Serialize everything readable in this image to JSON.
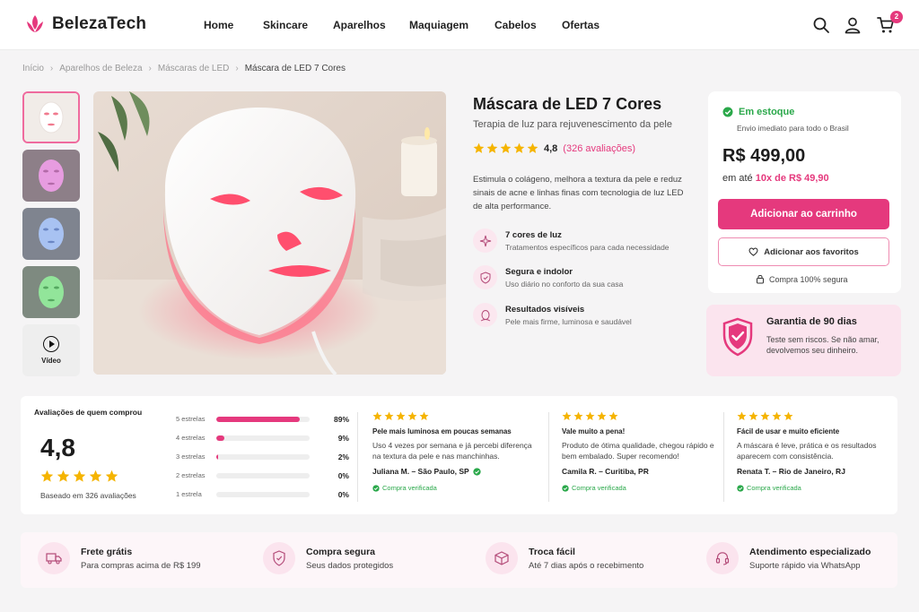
{
  "brand": {
    "name": "BelezaTech",
    "accent": "#e5397d"
  },
  "nav": [
    "Home",
    "Skincare",
    "Aparelhos",
    "Maquiagem",
    "Cabelos",
    "Ofertas"
  ],
  "header_icons": [
    "search-icon",
    "user-icon",
    "cart-icon"
  ],
  "cart_count": "2",
  "breadcrumb": [
    "Início",
    "Aparelhos de Beleza",
    "Máscaras de LED",
    "Máscara de LED 7 Cores"
  ],
  "gallery": {
    "thumbnails": [
      "white-mask",
      "pink-mask",
      "blue-mask",
      "green-mask"
    ],
    "video_label": "Vídeo"
  },
  "product": {
    "title": "Máscara de LED 7 Cores",
    "subtitle": "Terapia de luz para rejuvenescimento da pele",
    "rating": "4,8",
    "rating_count": "(326 avaliações)",
    "description": "Estimula o colágeno, melhora a textura da pele e reduz sinais de acne e linhas finas com tecnologia de luz LED de alta performance.",
    "features": [
      {
        "icon": "sparkle-icon",
        "title": "7 cores de luz",
        "subtitle": "Tratamentos específicos para cada necessidade"
      },
      {
        "icon": "shield-icon",
        "title": "Segura e indolor",
        "subtitle": "Uso diário no conforto da sua casa"
      },
      {
        "icon": "face-icon",
        "title": "Resultados visíveis",
        "subtitle": "Pele mais firme, luminosa e saudável"
      }
    ]
  },
  "buybox": {
    "stock": "Em estoque",
    "shipping": "Envio imediato para todo o Brasil",
    "price": "R$ 499,00",
    "installment_prefix": "em até",
    "installment": "10x de R$ 49,90",
    "add_to_cart": "Adicionar ao carrinho",
    "add_to_favorites": "Adicionar aos favoritos",
    "secure": "Compra 100% segura"
  },
  "guarantee": {
    "title": "Garantia de 90 dias",
    "text": "Teste sem riscos. Se não amar, devolvemos seu dinheiro."
  },
  "reviews": {
    "heading": "Avaliações de quem comprou",
    "average": "4,8",
    "based_on": "Baseado em 326 avaliações",
    "distribution": [
      {
        "label": "5 estrelas",
        "pct": "89%",
        "value": 89
      },
      {
        "label": "4 estrelas",
        "pct": "9%",
        "value": 9
      },
      {
        "label": "3 estrelas",
        "pct": "2%",
        "value": 2
      },
      {
        "label": "2 estrelas",
        "pct": "0%",
        "value": 0
      },
      {
        "label": "1 estrela",
        "pct": "0%",
        "value": 0
      }
    ],
    "items": [
      {
        "title": "Pele mais luminosa em poucas semanas",
        "text": "Uso 4 vezes por semana e já percebi diferença na textura da pele e nas manchinhas.",
        "author": "Juliana M. – São Paulo, SP",
        "verified": "Compra verificada"
      },
      {
        "title": "Vale muito a pena!",
        "text": "Produto de ótima qualidade, chegou rápido e bem embalado. Super recomendo!",
        "author": "Camila R. – Curitiba, PR",
        "verified": "Compra verificada"
      },
      {
        "title": "Fácil de usar e muito eficiente",
        "text": "A máscara é leve, prática e os resultados aparecem com consistência.",
        "author": "Renata T. – Rio de Janeiro, RJ",
        "verified": "Compra verificada"
      }
    ]
  },
  "benefits": [
    {
      "icon": "truck-icon",
      "title": "Frete grátis",
      "subtitle": "Para compras acima de R$ 199"
    },
    {
      "icon": "shield-icon",
      "title": "Compra segura",
      "subtitle": "Seus dados protegidos"
    },
    {
      "icon": "box-icon",
      "title": "Troca fácil",
      "subtitle": "Até 7 dias após o recebimento"
    },
    {
      "icon": "headset-icon",
      "title": "Atendimento especializado",
      "subtitle": "Suporte rápido via WhatsApp"
    }
  ]
}
